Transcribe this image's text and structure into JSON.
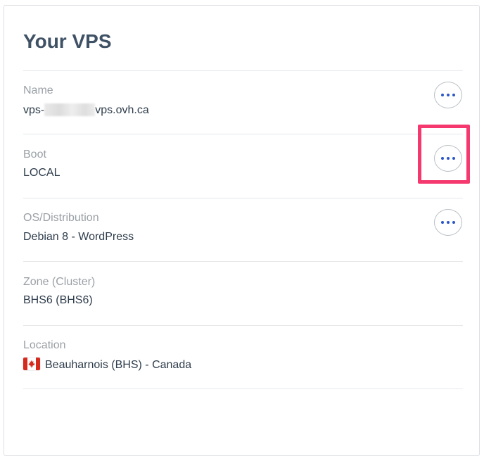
{
  "card": {
    "title": "Your VPS"
  },
  "rows": [
    {
      "label": "Name",
      "value_prefix": "vps-",
      "value_suffix": "vps.ovh.ca",
      "has_menu": true
    },
    {
      "label": "Boot",
      "value": "LOCAL",
      "has_menu": true
    },
    {
      "label": "OS/Distribution",
      "value": "Debian 8 - WordPress",
      "has_menu": true
    },
    {
      "label": "Zone (Cluster)",
      "value": "BHS6 (BHS6)",
      "has_menu": false
    },
    {
      "label": "Location",
      "value": "Beauharnois (BHS) - Canada",
      "flag": "canada-flag-icon",
      "has_menu": false
    }
  ],
  "icons": {
    "menu": "ellipsis-icon"
  },
  "colors": {
    "accent": "#2a56c6",
    "highlight": "#f5386e",
    "title": "#3f5164",
    "label": "#9aa0a6"
  }
}
